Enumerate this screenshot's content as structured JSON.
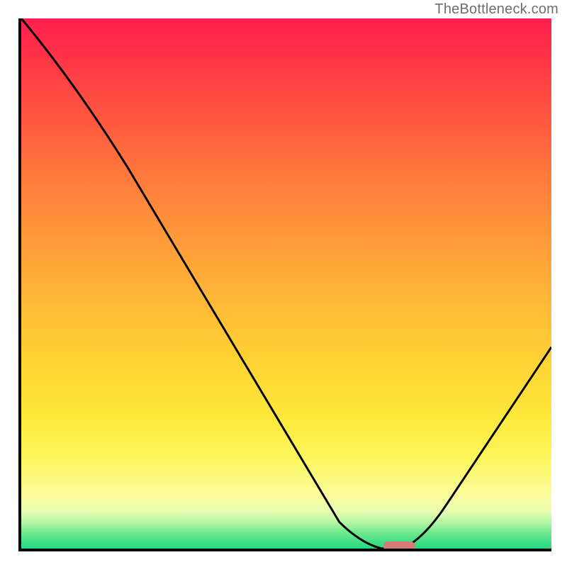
{
  "watermark": "TheBottleneck.com",
  "chart_data": {
    "type": "line",
    "title": "",
    "xlabel": "",
    "ylabel": "",
    "xlim": [
      0,
      100
    ],
    "ylim": [
      0,
      100
    ],
    "series": [
      {
        "name": "bottleneck-curve",
        "x": [
          0,
          20,
          60,
          68,
          72,
          100
        ],
        "values": [
          100,
          72,
          5,
          0,
          0,
          38
        ]
      }
    ],
    "annotations": [
      {
        "name": "optimal-marker",
        "x_start": 68,
        "x_end": 74,
        "y": 0
      }
    ],
    "background_gradient": {
      "top": "#ff1f4e",
      "mid": "#ffd634",
      "bottom": "#25d884"
    }
  },
  "colors": {
    "axis": "#000000",
    "curve": "#000000",
    "marker": "#d87a78",
    "watermark": "#6e6e6e"
  }
}
